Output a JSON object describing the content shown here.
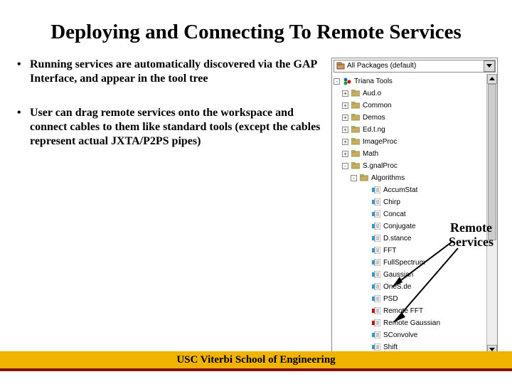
{
  "title": "Deploying and Connecting To Remote Services",
  "bullets": [
    "Running services are automatically discovered via the GAP Interface, and appear in the tool tree",
    "User can drag remote services onto the workspace and connect cables to them like standard tools (except the cables represent actual JXTA/P2PS pipes)"
  ],
  "dropdown": {
    "label": "All Packages (default)"
  },
  "tree": {
    "root": "Triana Tools",
    "folders": [
      "Aud.o",
      "Common",
      "Demos",
      "Ed.t.ng",
      "ImageProc",
      "Math",
      "S.gnalProc"
    ],
    "expanded": "Algorithms",
    "leaves": [
      "AccumStat",
      "Chirp",
      "Concat",
      "Conjugate",
      "D.stance",
      "FFT",
      "FullSpectrum",
      "Gaussian",
      "OneS.de",
      "PSD",
      "Remote FFT",
      "Remote Gaussian",
      "SConvolve",
      "Shift"
    ]
  },
  "annotation": {
    "line1": "Remote",
    "line2": "Services"
  },
  "footer": "USC Viterbi School of Engineering"
}
